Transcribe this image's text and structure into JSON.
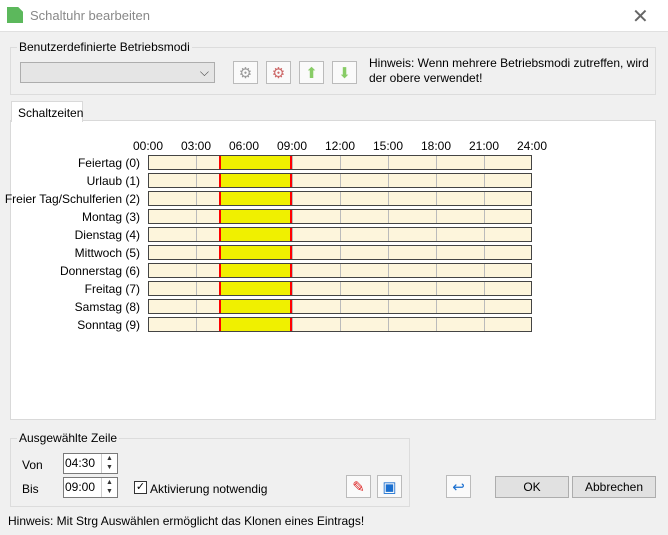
{
  "window": {
    "title": "Schaltuhr bearbeiten"
  },
  "modes": {
    "group_label": "Benutzerdefinierte Betriebsmodi",
    "selected": "",
    "hint": "Hinweis: Wenn mehrere Betriebsmodi zutreffen, wird der obere verwendet!"
  },
  "tabs": [
    {
      "label": "Schaltzeiten"
    }
  ],
  "schedule": {
    "hours": [
      "00:00",
      "03:00",
      "06:00",
      "09:00",
      "12:00",
      "15:00",
      "18:00",
      "21:00",
      "24:00"
    ],
    "rows": [
      {
        "label": "Feiertag (0)",
        "selected": true
      },
      {
        "label": "Urlaub (1)"
      },
      {
        "label": "Freier Tag/Schulferien (2)"
      },
      {
        "label": "Montag (3)"
      },
      {
        "label": "Dienstag (4)"
      },
      {
        "label": "Mittwoch (5)"
      },
      {
        "label": "Donnerstag (6)"
      },
      {
        "label": "Freitag (7)"
      },
      {
        "label": "Samstag (8)"
      },
      {
        "label": "Sonntag (9)"
      }
    ],
    "interval_start_hours": 4.5,
    "interval_end_hours": 9.0,
    "colors": {
      "active": "#f0f000",
      "background": "#fdf5dc",
      "border": "#ff0000",
      "hatch": "#0000ff"
    }
  },
  "selection": {
    "group_label": "Ausgewählte Zeile",
    "from_label": "Von",
    "from_value": "04:30",
    "to_label": "Bis",
    "to_value": "09:00",
    "activation_label": "Aktivierung notwendig",
    "activation_checked": true
  },
  "buttons": {
    "ok": "OK",
    "cancel": "Abbrechen"
  },
  "footer_hint": "Hinweis: Mit Strg Auswählen ermöglicht das Klonen eines Eintrags!"
}
